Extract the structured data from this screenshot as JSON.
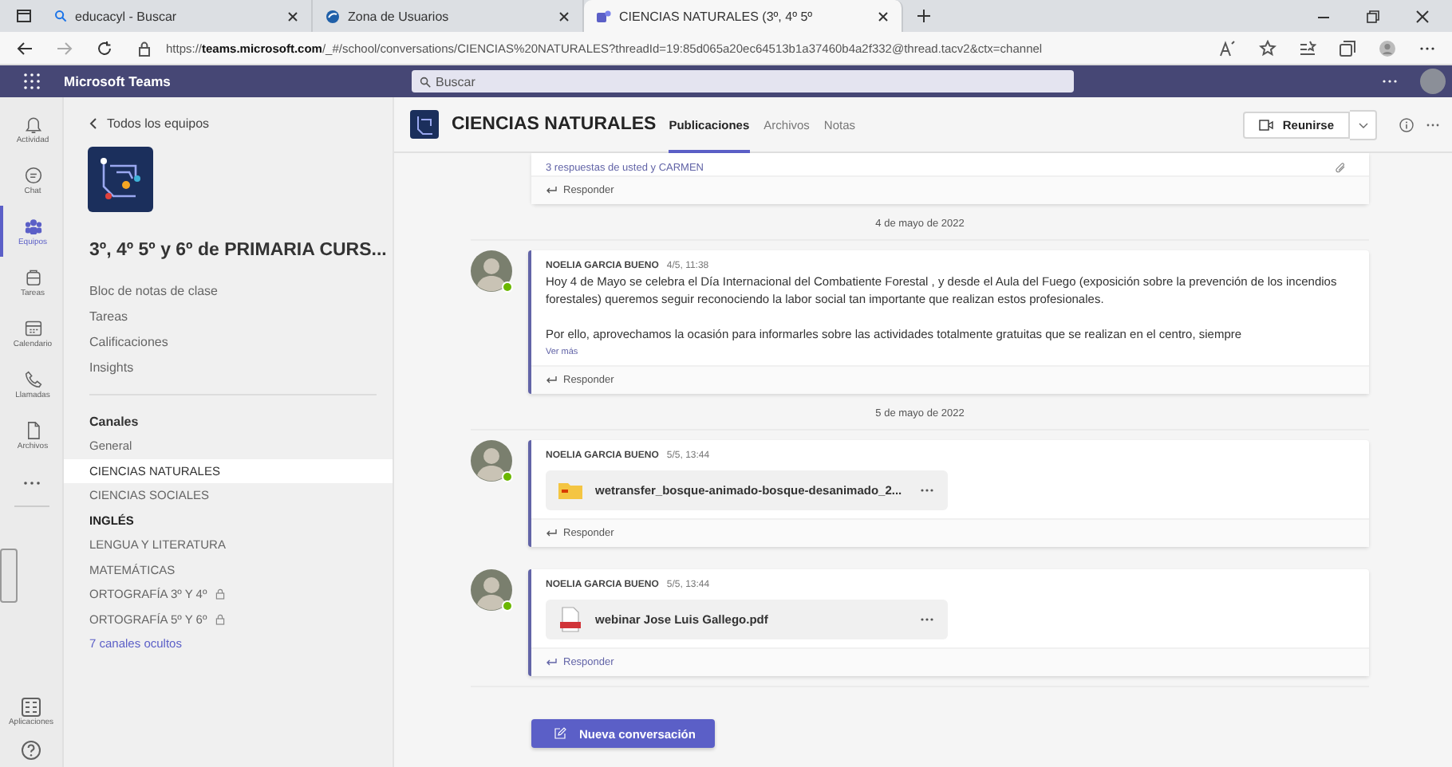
{
  "browser": {
    "tabs": [
      {
        "title": "educacyl - Buscar",
        "selected": false
      },
      {
        "title": "Zona de Usuarios",
        "selected": false
      },
      {
        "title": "CIENCIAS NATURALES (3º, 4º 5º",
        "selected": true
      }
    ],
    "url": "https://**teams.microsoft.com**/_#/school/conversations/CIENCIAS%20NATURALES?threadId=19:85d065a20ec64513b1a37460b4a2f332@thread.tacv2&ctx=channel"
  },
  "app": {
    "name": "Microsoft Teams",
    "search_placeholder": "Buscar"
  },
  "rail": {
    "items": [
      {
        "label": "Actividad",
        "selected": false
      },
      {
        "label": "Chat",
        "selected": false
      },
      {
        "label": "Equipos",
        "selected": true
      },
      {
        "label": "Tareas",
        "selected": false
      },
      {
        "label": "Calendario",
        "selected": false
      },
      {
        "label": "Llamadas",
        "selected": false
      },
      {
        "label": "Archivos",
        "selected": false
      }
    ],
    "apps_label": "Aplicaciones"
  },
  "team": {
    "back_link": "Todos los equipos",
    "name": "3º, 4º 5º y 6º de PRIMARIA CURS...",
    "links": [
      "Bloc de notas de clase",
      "Tareas",
      "Calificaciones",
      "Insights"
    ],
    "channels_header": "Canales",
    "channels": [
      {
        "name": "General",
        "selected": false,
        "unread": false,
        "locked": false
      },
      {
        "name": "CIENCIAS NATURALES",
        "selected": true,
        "unread": false,
        "locked": false
      },
      {
        "name": "CIENCIAS SOCIALES",
        "selected": false,
        "unread": false,
        "locked": false
      },
      {
        "name": "INGLÉS",
        "selected": false,
        "unread": true,
        "locked": false
      },
      {
        "name": "LENGUA Y LITERATURA",
        "selected": false,
        "unread": false,
        "locked": false
      },
      {
        "name": "MATEMÁTICAS",
        "selected": false,
        "unread": false,
        "locked": false
      },
      {
        "name": "ORTOGRAFÍA 3º Y 4º",
        "selected": false,
        "unread": false,
        "locked": true
      },
      {
        "name": "ORTOGRAFÍA 5º Y 6º",
        "selected": false,
        "unread": false,
        "locked": true
      }
    ],
    "hidden_link": "7 canales ocultos"
  },
  "channel": {
    "name": "CIENCIAS NATURALES",
    "tabs": [
      {
        "label": "Publicaciones",
        "selected": true
      },
      {
        "label": "Archivos",
        "selected": false
      },
      {
        "label": "Notas",
        "selected": false
      }
    ],
    "meet_label": "Reunirse"
  },
  "feed": [
    {
      "kind": "thread_tail",
      "replies": "3 respuestas de usted y CARMEN",
      "reply": "Responder",
      "reply_highlighted": false
    },
    {
      "kind": "date",
      "text": "4 de mayo de 2022"
    },
    {
      "kind": "message",
      "author": "NOELIA GARCIA BUENO",
      "time": "4/5, 11:38",
      "paragraphs": [
        "Hoy 4 de Mayo se celebra el   Día Internacional del Combatiente Forestal , y desde el Aula del Fuego (exposición sobre la prevención de los incendios forestales) queremos seguir reconociendo la labor social tan importante que realizan estos profesionales.",
        "Por ello, aprovechamos la ocasión para informarles sobre las actividades totalmente gratuitas que se realizan en el centro, siempre"
      ],
      "more": "Ver más",
      "reply": "Responder",
      "reply_highlighted": false
    },
    {
      "kind": "date",
      "text": "5 de mayo de 2022"
    },
    {
      "kind": "file",
      "author": "NOELIA GARCIA BUENO",
      "time": "5/5, 13:44",
      "file": {
        "kind": "folder",
        "name": "wetransfer_bosque-animado-bosque-desanimado_2..."
      },
      "reply": "Responder",
      "reply_highlighted": false
    },
    {
      "kind": "file",
      "author": "NOELIA GARCIA BUENO",
      "time": "5/5, 13:44",
      "file": {
        "kind": "pdf",
        "name": "webinar Jose Luis Gallego.pdf"
      },
      "reply": "Responder",
      "reply_highlighted": true
    }
  ],
  "new_conversation": "Nueva conversación"
}
